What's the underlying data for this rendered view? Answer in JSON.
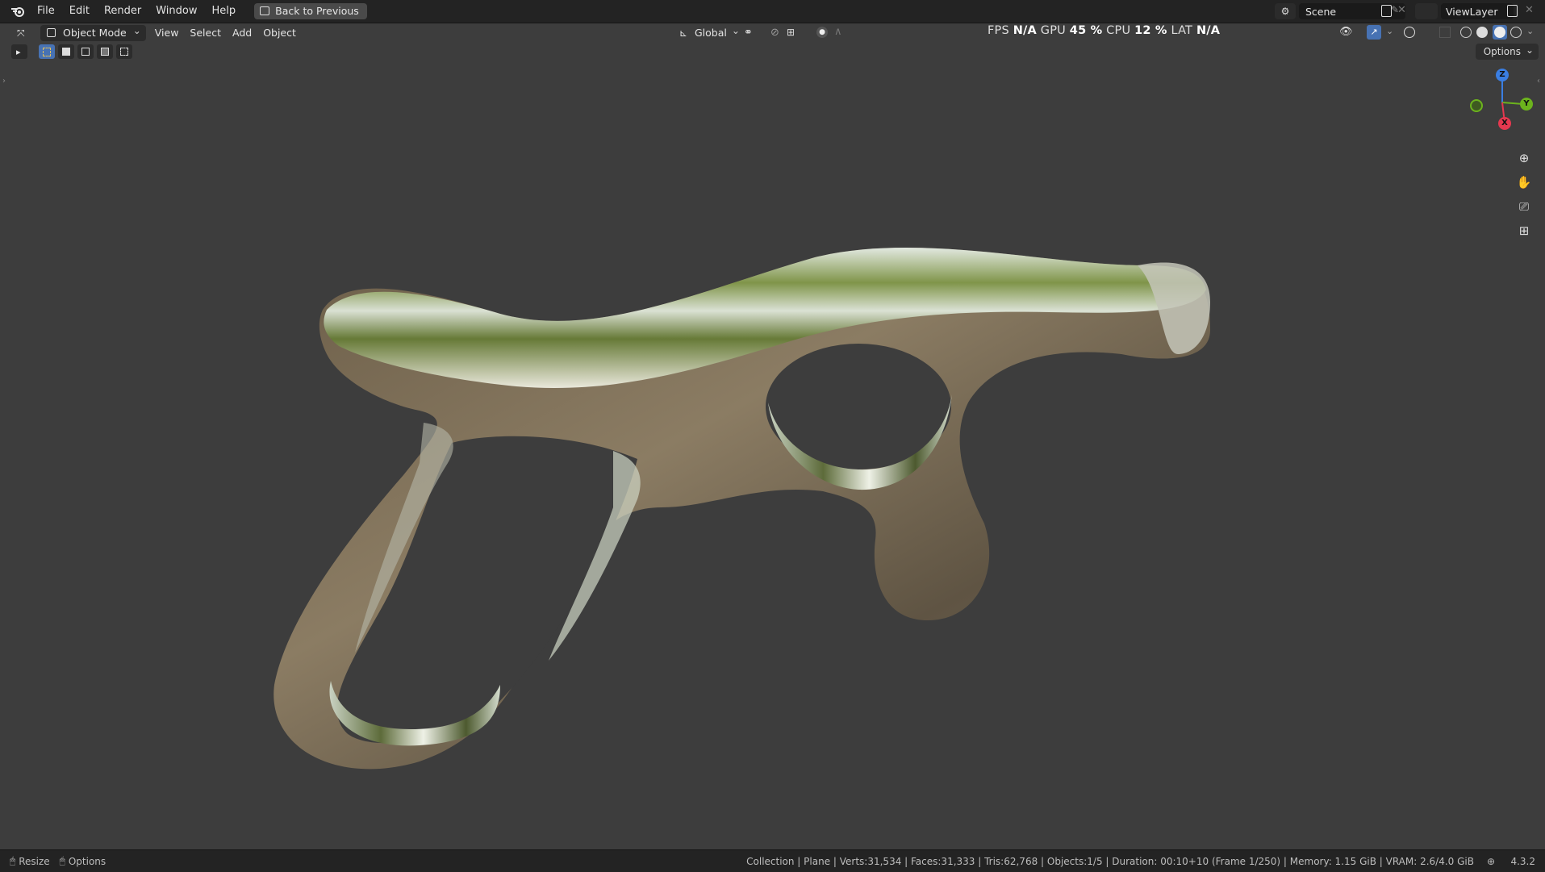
{
  "top_menu": {
    "items": [
      "File",
      "Edit",
      "Render",
      "Window",
      "Help"
    ],
    "back_button": "Back to Previous",
    "scene": "Scene",
    "view_layer": "ViewLayer"
  },
  "viewport_header": {
    "mode": "Object Mode",
    "menus": [
      "View",
      "Select",
      "Add",
      "Object"
    ],
    "orientation": "Global",
    "options": "Options"
  },
  "stats": {
    "fps_label": "FPS",
    "fps": "N/A",
    "gpu_label": "GPU",
    "gpu": "45 %",
    "cpu_label": "CPU",
    "cpu": "12 %",
    "lat_label": "LAT",
    "lat": "N/A"
  },
  "gizmo": {
    "z": "Z",
    "y": "Y",
    "x": "X"
  },
  "statusbar": {
    "left_resize": "Resize",
    "left_options": "Options",
    "info": "Collection | Plane | Verts:31,534 | Faces:31,333 | Tris:62,768 | Objects:1/5 | Duration: 00:10+10 (Frame 1/250) | Memory: 1.15 GiB | VRAM: 2.6/4.0 GiB",
    "version": "4.3.2"
  },
  "colors": {
    "viewport_bg": "#3d3d3d",
    "axis_x": "#e5384f",
    "axis_y": "#6cb31d",
    "axis_z": "#3a7ee2",
    "accent": "#4772b3"
  }
}
